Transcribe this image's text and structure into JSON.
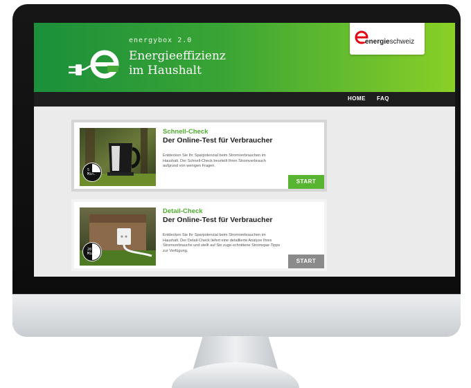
{
  "colors": {
    "brand_green": "#58b532",
    "title_green": "#4fae2f",
    "nav_bg": "#1e1e1e",
    "start_inactive": "#8a8a8a"
  },
  "header": {
    "app_name": "energybox 2.0",
    "title_line1": "Energieeffizienz",
    "title_line2": "im Haushalt",
    "logo_icon": "plug-e-icon"
  },
  "brand": {
    "name_bold": "energie",
    "name_regular": "schweiz"
  },
  "nav": {
    "home": "HOME",
    "faq": "FAQ"
  },
  "cards": [
    {
      "title": "Schnell-Check",
      "subtitle": "Der Online-Test für Verbraucher",
      "text": "Entdecken Sie Ihr Sparpotenzial beim Stromverbrauchen im Haushalt. Der Schnell-Check beurteilt Ihren Stromverbrauch aufgrund von wenigen Fragen.",
      "duration_num": "5",
      "duration_unit": "Min.",
      "duration_fraction": 0.25,
      "button": "START",
      "image_icon": "kettle-photo-icon"
    },
    {
      "title": "Detail-Check",
      "subtitle": "Der Online-Test für Verbraucher",
      "text": "Entdecken Sie Ihr Sparpotenzial beim Stromverbrauchen im Haushalt. Der Detail-Check liefert eine detaillierte Analyse Ihres Stromverbrauchs und stellt auf Sie zuge-schnittene Stromspar-Tipps zur Verfügung.",
      "duration_num": "20",
      "duration_unit": "Min.",
      "duration_fraction": 0.5,
      "button": "START",
      "image_icon": "socket-photo-icon"
    }
  ]
}
